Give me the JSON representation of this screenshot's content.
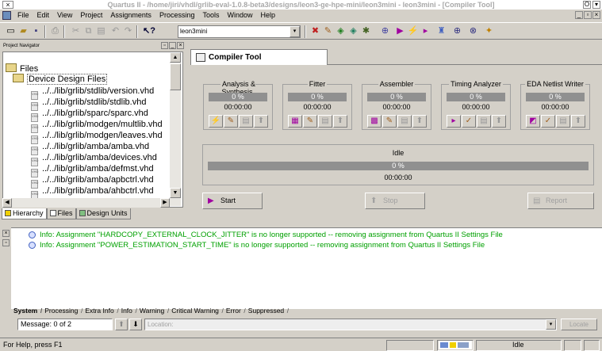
{
  "window": {
    "title": "Quartus II - /home/jiri/vhdl/grlib-eval-1.0.8-beta3/designs/leon3-ge-hpe-mini/leon3mini - leon3mini - [Compiler Tool]",
    "close_glyph": "×",
    "min_glyph": "O",
    "max_glyph": "▾"
  },
  "menubar": {
    "items": [
      "File",
      "Edit",
      "View",
      "Project",
      "Assignments",
      "Processing",
      "Tools",
      "Window",
      "Help"
    ],
    "mdi": [
      "_",
      "▫",
      "×"
    ]
  },
  "toolbar": {
    "project_combo_value": "leon3mini",
    "combo_arrow": "▾",
    "icons": [
      "new-file-icon",
      "open-folder-icon",
      "save-icon",
      "print-icon",
      "cut-icon",
      "copy-icon",
      "paste-icon",
      "undo-icon",
      "redo-icon",
      "help-pointer-icon",
      "settings-icon",
      "pin-planner-icon",
      "timing-icon",
      "chip-icon",
      "power-icon",
      "compile-icon",
      "analysis-icon",
      "start-icon",
      "rtl-icon",
      "floorplan-icon",
      "programmer-icon",
      "signaltap-icon",
      "megawizard-icon"
    ]
  },
  "navigator": {
    "title": "Project Navigator",
    "controls": [
      "▫",
      "_",
      "×"
    ],
    "files_folder": "Files",
    "design_folder": "Device Design Files",
    "file_type": "VHD",
    "files": [
      "../../lib/grlib/stdlib/version.vhd",
      "../../lib/grlib/stdlib/stdlib.vhd",
      "../../lib/grlib/sparc/sparc.vhd",
      "../../lib/grlib/modgen/multlib.vhd",
      "../../lib/grlib/modgen/leaves.vhd",
      "../../lib/grlib/amba/amba.vhd",
      "../../lib/grlib/amba/devices.vhd",
      "../../lib/grlib/amba/defmst.vhd",
      "../../lib/grlib/amba/apbctrl.vhd",
      "../../lib/grlib/amba/ahbctrl.vhd"
    ],
    "tabs": [
      "Hierarchy",
      "Files",
      "Design Units"
    ],
    "scroll_up": "▲",
    "scroll_down": "▼",
    "scroll_left": "◀",
    "scroll_right": "▶"
  },
  "compiler": {
    "tab_title": "Compiler Tool",
    "stages": [
      {
        "name": "Analysis & Synthesis",
        "percent": "0 %",
        "time": "00:00:00",
        "icons": [
          "⚡",
          "✎",
          "▤",
          "⬆"
        ]
      },
      {
        "name": "Fitter",
        "percent": "0 %",
        "time": "00:00:00",
        "icons": [
          "▦",
          "✎",
          "▤",
          "⬆"
        ]
      },
      {
        "name": "Assembler",
        "percent": "0 %",
        "time": "00:00:00",
        "icons": [
          "▩",
          "✎",
          "▤",
          "⬆"
        ]
      },
      {
        "name": "Timing Analyzer",
        "percent": "0 %",
        "time": "00:00:00",
        "icons": [
          "▸",
          "✓",
          "▤",
          "⬆"
        ]
      },
      {
        "name": "EDA Netlist Writer",
        "percent": "0 %",
        "time": "00:00:00",
        "icons": [
          "◩",
          "✓",
          "▤",
          "⬆"
        ]
      }
    ],
    "overall": {
      "state": "Idle",
      "percent": "0 %",
      "time": "00:00:00"
    },
    "buttons": {
      "start": "Start",
      "stop": "Stop",
      "report": "Report"
    },
    "button_icons": {
      "start": "▶",
      "stop": "⬆",
      "report": "▤"
    }
  },
  "messages": {
    "lines": [
      "Info: Assignment \"HARDCOPY_EXTERNAL_CLOCK_JITTER\" is no longer supported -- removing assignment from Quartus II Settings File",
      "Info: Assignment \"POWER_ESTIMATION_START_TIME\" is no longer supported -- removing assignment from Quartus II Settings File"
    ],
    "tabs": [
      "System",
      "Processing",
      "Extra Info",
      "Info",
      "Warning",
      "Critical Warning",
      "Error",
      "Suppressed"
    ],
    "count": "Message: 0 of 2",
    "location_placeholder": "Location:",
    "locate": "Locate",
    "up": "⬆",
    "down": "⬇",
    "loc_arrow": "▾",
    "side_controls": [
      "×",
      "▫"
    ],
    "text_color": "#00a000"
  },
  "statusbar": {
    "text": "For Help, press F1",
    "state": "Idle"
  },
  "colors": {
    "bar_fill": "#909090",
    "chrome": "#d4d0c8"
  }
}
